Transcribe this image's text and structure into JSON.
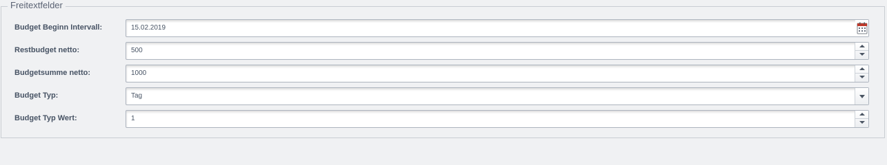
{
  "fieldset": {
    "legend": "Freitextfelder"
  },
  "fields": [
    {
      "label": "Budget Beginn Intervall:",
      "value": "15.02.2019",
      "control": "date",
      "icon": "calendar-icon"
    },
    {
      "label": "Restbudget netto:",
      "value": "500",
      "control": "number"
    },
    {
      "label": "Budgetsumme netto:",
      "value": "1000",
      "control": "number"
    },
    {
      "label": "Budget Typ:",
      "value": "Tag",
      "control": "select",
      "icon": "chevron-down-icon"
    },
    {
      "label": "Budget Typ Wert:",
      "value": "1",
      "control": "number"
    }
  ],
  "colors": {
    "background": "#f0f1f3",
    "label_text": "#475364",
    "field_border": "#aeb5bf",
    "calendar_accent": "#c0392b"
  }
}
